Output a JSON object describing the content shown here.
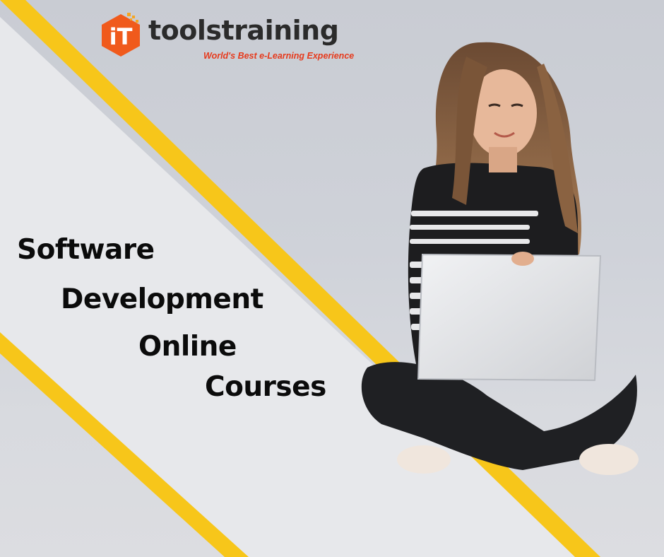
{
  "brand": {
    "name": "toolstraining",
    "badge_text": "iT",
    "tagline": "World's Best e-Learning Experience",
    "badge_color": "#f05a1c",
    "tagline_color": "#e63a1c",
    "name_color": "#2b2b2b"
  },
  "headline": {
    "lines": [
      "Software",
      "Development",
      "Online",
      "Courses"
    ],
    "color": "#0b0b0b"
  },
  "colors": {
    "accent_stripe": "#f7c61a",
    "panel": "#e6e7ea",
    "background": "#cfd2d9"
  },
  "photo": {
    "subject": "woman-with-laptop"
  }
}
